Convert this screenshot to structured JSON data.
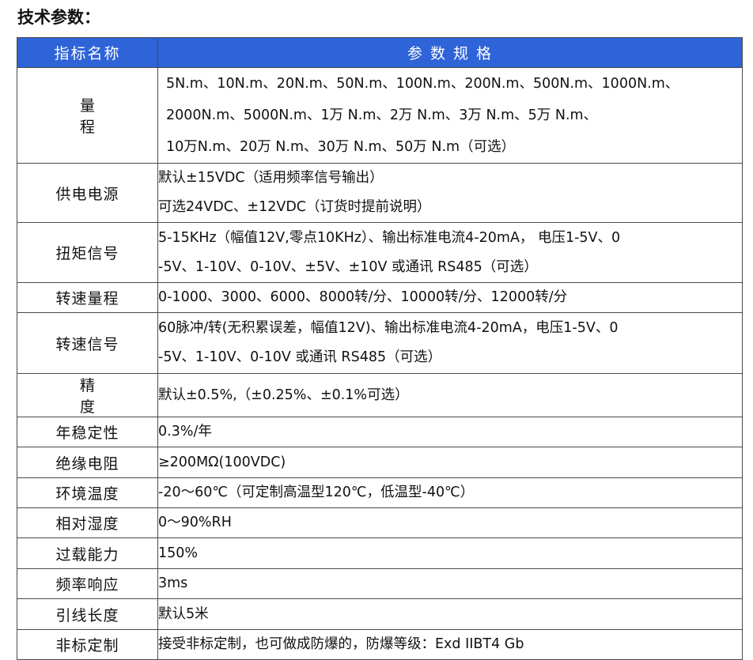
{
  "heading": "技术参数：",
  "table": {
    "header_name": "指标名称",
    "header_spec": "参 数 规 格",
    "rows": [
      {
        "name": "量程",
        "value": "5N.m、10N.m、20N.m、50N.m、100N.m、200N.m、500N.m、1000N.m、\n2000N.m、5000N.m、1万 N.m、2万 N.m、3万 N.m、5万 N.m、\n10万N.m、20万 N.m、30万 N.m、50万 N.m（可选）"
      },
      {
        "name": "供电电源",
        "value": "默认±15VDC（适用频率信号输出）\n可选24VDC、±12VDC（订货时提前说明）"
      },
      {
        "name": "扭矩信号",
        "value": "5-15KHz（幅值12V,零点10KHz）、输出标准电流4-20mA， 电压1-5V、0\n-5V、1-10V、0-10V、±5V、±10V 或通讯 RS485（可选）"
      },
      {
        "name": "转速量程",
        "value": "0-1000、3000、6000、8000转/分、10000转/分、12000转/分"
      },
      {
        "name": "转速信号",
        "value": "60脉冲/转(无积累误差，幅值12V)、输出标准电流4-20mA，电压1-5V、0\n-5V、1-10V、0-10V 或通讯 RS485（可选）"
      },
      {
        "name": "精度",
        "value": "默认±0.5%,（±0.25%、±0.1%可选）"
      },
      {
        "name": "年稳定性",
        "value": "0.3%/年"
      },
      {
        "name": "绝缘电阻",
        "value": "≥200MΩ(100VDC)"
      },
      {
        "name": "环境温度",
        "value": "-20～60℃（可定制高温型120℃，低温型-40℃）"
      },
      {
        "name": "相对湿度",
        "value": "0～90%RH"
      },
      {
        "name": "过载能力",
        "value": "150%"
      },
      {
        "name": "频率响应",
        "value": "3ms"
      },
      {
        "name": "引线长度",
        "value": "默认5米"
      },
      {
        "name": "非标定制",
        "value": "接受非标定制，也可做成防爆的，防爆等级：Exd IIBT4 Gb"
      }
    ]
  }
}
